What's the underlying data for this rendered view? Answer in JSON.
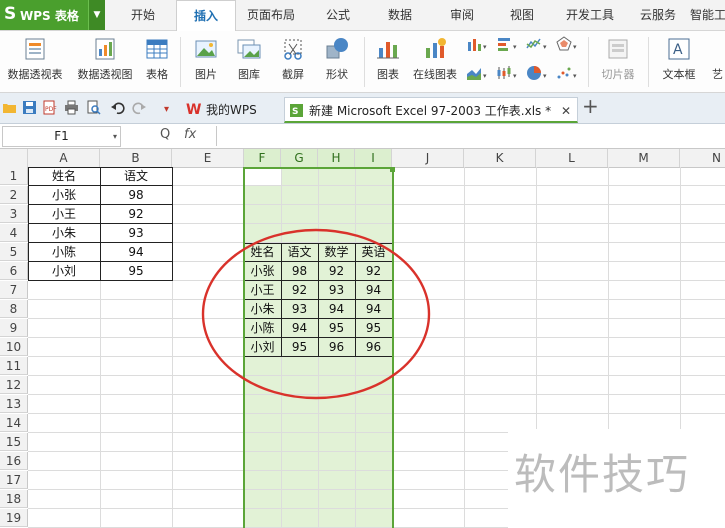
{
  "app": {
    "logo_glyph": "S",
    "name": "WPS 表格"
  },
  "menu": [
    "开始",
    "插入",
    "页面布局",
    "公式",
    "数据",
    "审阅",
    "视图",
    "开发工具",
    "云服务",
    "智能工"
  ],
  "ribbon": {
    "pivot_table": "数据透视表",
    "pivot_chart": "数据透视图",
    "table": "表格",
    "picture": "图片",
    "gallery": "图库",
    "screenshot": "截屏",
    "shapes": "形状",
    "chart": "图表",
    "online_chart": "在线图表",
    "slicer": "切片器",
    "textbox": "文本框",
    "art_text": "艺"
  },
  "tabs": {
    "my_wps": "我的WPS",
    "workbook": "新建 Microsoft Excel 97-2003 工作表.xls *"
  },
  "formula": {
    "cell_ref": "F1",
    "fx": "fx",
    "zoom_glyph": "Q"
  },
  "columns": [
    "A",
    "B",
    "E",
    "F",
    "G",
    "H",
    "I",
    "J",
    "K",
    "L",
    "M",
    "N"
  ],
  "rows": [
    "1",
    "2",
    "3",
    "4",
    "5",
    "6",
    "7",
    "8",
    "9",
    "10",
    "11",
    "12",
    "13",
    "14",
    "15",
    "16",
    "17",
    "18",
    "19"
  ],
  "table_ab": [
    [
      "姓名",
      "语文"
    ],
    [
      "小张",
      "98"
    ],
    [
      "小王",
      "92"
    ],
    [
      "小朱",
      "93"
    ],
    [
      "小陈",
      "94"
    ],
    [
      "小刘",
      "95"
    ]
  ],
  "table_fi": [
    [
      "姓名",
      "语文",
      "数学",
      "英语"
    ],
    [
      "小张",
      "98",
      "92",
      "92"
    ],
    [
      "小王",
      "92",
      "93",
      "94"
    ],
    [
      "小朱",
      "93",
      "94",
      "94"
    ],
    [
      "小陈",
      "94",
      "95",
      "95"
    ],
    [
      "小刘",
      "95",
      "96",
      "96"
    ]
  ],
  "watermark": "软件技巧",
  "colors": {
    "wps_green": "#4a9f2d",
    "selection_fill": "#e2f2d6",
    "selection_border": "#5ba538",
    "annotation_red": "#d9322b"
  }
}
